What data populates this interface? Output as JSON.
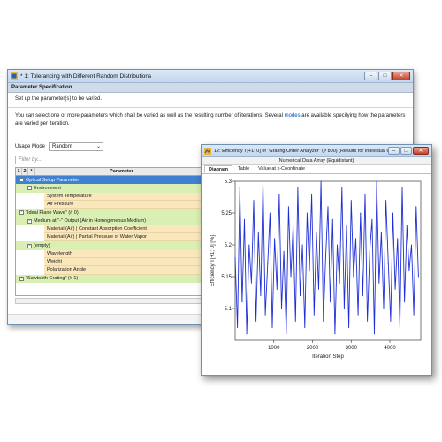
{
  "main_window": {
    "title": "* 1: Tolerancing with Different Random Distributions",
    "section_title": "Parameter Specification",
    "subtitle": "Set up the parameter(s) to be varied.",
    "description_before": "You can select one or more parameters which shall be varied as well as the resulting number of iterations. Several ",
    "description_link": "modes",
    "description_after": " are available specifying how the parameters are varied per iteration.",
    "usage_mode_label": "Usage Mode",
    "usage_mode_value": "Random",
    "filter_placeholder": "Filter by...",
    "grid_headers": {
      "c1": "1",
      "c2": "2",
      "c3": "*",
      "parameter": "Parameter",
      "value": "Va"
    },
    "rows": [
      {
        "text": "Optical Setup Parameter",
        "kind": "top",
        "indent": 0,
        "toggle": "-",
        "check": ""
      },
      {
        "text": "Environment",
        "kind": "grp",
        "indent": 1,
        "toggle": "-",
        "check": ""
      },
      {
        "text": "System Temperature",
        "kind": "item",
        "indent": 2,
        "toggle": "",
        "check": "off"
      },
      {
        "text": "Air Pressure",
        "kind": "item",
        "indent": 2,
        "toggle": "",
        "check": "off"
      },
      {
        "text": "\"Ideal Plane Wave\" (# 0)",
        "kind": "grp",
        "indent": 0,
        "toggle": "-",
        "check": ""
      },
      {
        "text": "Medium at \"-\" Output (Air in Homogeneous Medium)",
        "kind": "grp",
        "indent": 1,
        "toggle": "-",
        "check": ""
      },
      {
        "text": "Material (Air) | Constant Absorption Coefficient",
        "kind": "item",
        "indent": 2,
        "toggle": "",
        "check": "off"
      },
      {
        "text": "Material (Air) | Partial Pressure of Water Vapor",
        "kind": "item",
        "indent": 2,
        "toggle": "",
        "check": "off"
      },
      {
        "text": "(empty)",
        "kind": "grp",
        "indent": 1,
        "toggle": "-",
        "check": ""
      },
      {
        "text": "Wavelength",
        "kind": "item",
        "indent": 2,
        "toggle": "",
        "check": "on"
      },
      {
        "text": "Weight",
        "kind": "item",
        "indent": 2,
        "toggle": "",
        "check": "off"
      },
      {
        "text": "Polarization Angle",
        "kind": "item",
        "indent": 2,
        "toggle": "",
        "check": "off"
      },
      {
        "text": "\"Sawtooth Grating\" (# 1)",
        "kind": "grp",
        "indent": 0,
        "toggle": "+",
        "check": ""
      }
    ]
  },
  "chart_window": {
    "title": "12: Efficiency T[+1; 0] of \"Grating Order Analyzer\" (# 800) (Results for Individual Order...",
    "subheader": "Numerical Data Array (Equidistant)",
    "tabs": [
      "Diagram",
      "Table",
      "Value at x-Coordinate"
    ]
  },
  "chart_data": {
    "type": "line",
    "xlabel": "Iteration Step",
    "ylabel": "Efficiency T[+1; 0] [%]",
    "xlim": [
      0,
      4800
    ],
    "ylim": [
      5.05,
      5.3
    ],
    "xticks": [
      1000,
      2000,
      3000,
      4000
    ],
    "yticks": [
      5.1,
      5.15,
      5.2,
      5.25,
      5.3
    ],
    "series_color": "#1f2fd6",
    "x": [
      0,
      60,
      120,
      180,
      240,
      300,
      360,
      420,
      480,
      540,
      600,
      660,
      720,
      780,
      840,
      900,
      960,
      1020,
      1080,
      1140,
      1200,
      1260,
      1320,
      1380,
      1440,
      1500,
      1560,
      1620,
      1680,
      1740,
      1800,
      1860,
      1920,
      1980,
      2040,
      2100,
      2160,
      2220,
      2280,
      2340,
      2400,
      2460,
      2520,
      2580,
      2640,
      2700,
      2760,
      2820,
      2880,
      2940,
      3000,
      3060,
      3120,
      3180,
      3240,
      3300,
      3360,
      3420,
      3480,
      3540,
      3600,
      3660,
      3720,
      3780,
      3840,
      3900,
      3960,
      4020,
      4080,
      4140,
      4200,
      4260,
      4320,
      4380,
      4440,
      4500,
      4560,
      4620,
      4680,
      4740
    ],
    "values": [
      5.18,
      5.07,
      5.29,
      5.11,
      5.24,
      5.06,
      5.2,
      5.14,
      5.27,
      5.08,
      5.22,
      5.12,
      5.3,
      5.09,
      5.17,
      5.25,
      5.07,
      5.21,
      5.13,
      5.28,
      5.1,
      5.19,
      5.06,
      5.26,
      5.15,
      5.23,
      5.08,
      5.29,
      5.12,
      5.2,
      5.07,
      5.25,
      5.16,
      5.28,
      5.09,
      5.22,
      5.13,
      5.3,
      5.08,
      5.18,
      5.26,
      5.11,
      5.24,
      5.06,
      5.2,
      5.14,
      5.29,
      5.1,
      5.23,
      5.07,
      5.27,
      5.15,
      5.21,
      5.09,
      5.25,
      5.12,
      5.28,
      5.08,
      5.19,
      5.24,
      5.06,
      5.3,
      5.14,
      5.22,
      5.1,
      5.27,
      5.17,
      5.08,
      5.25,
      5.13,
      5.21,
      5.07,
      5.29,
      5.11,
      5.23,
      5.16,
      5.2,
      5.09,
      5.26,
      5.15
    ]
  }
}
